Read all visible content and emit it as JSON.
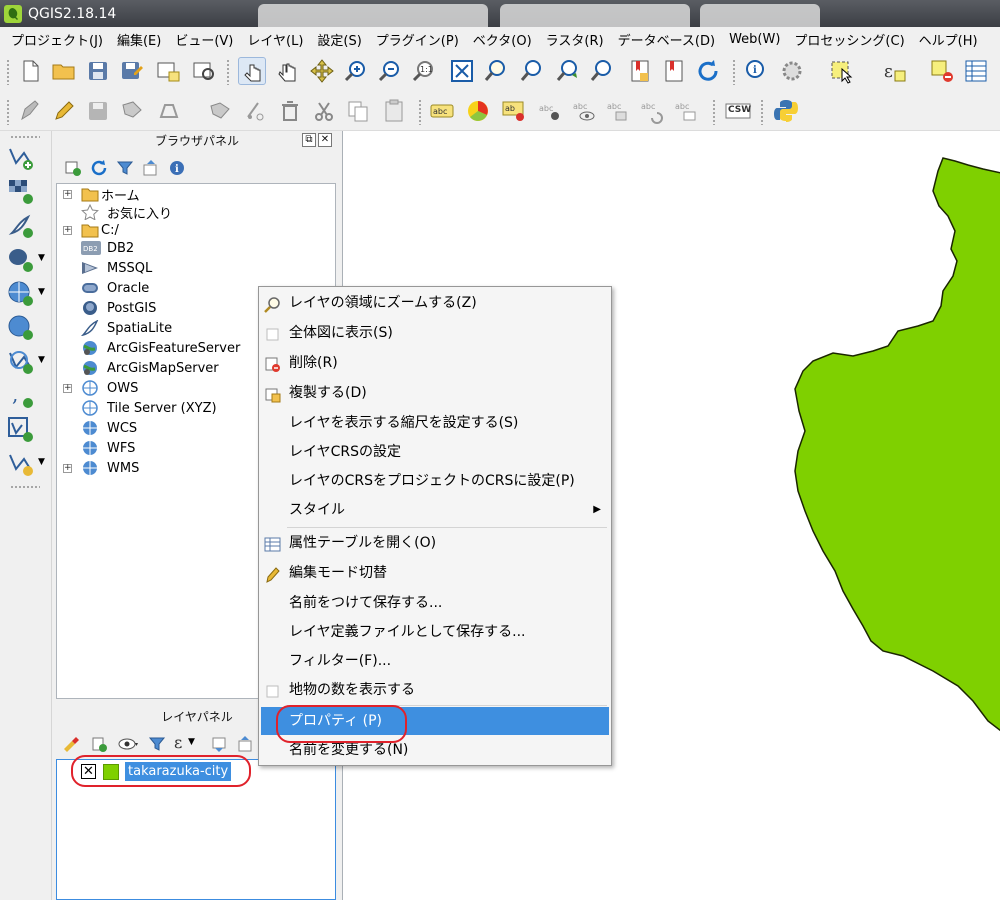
{
  "window": {
    "title": "QGIS2.18.14"
  },
  "menubar": {
    "items": [
      "プロジェクト(J)",
      "編集(E)",
      "ビュー(V)",
      "レイヤ(L)",
      "設定(S)",
      "プラグイン(P)",
      "ベクタ(O)",
      "ラスタ(R)",
      "データベース(D)",
      "Web(W)",
      "プロセッシング(C)",
      "ヘルプ(H)"
    ]
  },
  "toolbar2": {
    "csw_label": "CSW"
  },
  "browser_panel": {
    "title": "ブラウザパネル",
    "items": [
      {
        "label": "ホーム",
        "icon": "folder-icon"
      },
      {
        "label": "お気に入り",
        "icon": "star-icon"
      },
      {
        "label": "C:/",
        "icon": "folder-icon"
      },
      {
        "label": "DB2",
        "icon": "db2-icon"
      },
      {
        "label": "MSSQL",
        "icon": "mssql-icon"
      },
      {
        "label": "Oracle",
        "icon": "oracle-icon"
      },
      {
        "label": "PostGIS",
        "icon": "postgis-icon"
      },
      {
        "label": "SpatiaLite",
        "icon": "spatialite-icon"
      },
      {
        "label": "ArcGisFeatureServer",
        "icon": "arcgis-icon"
      },
      {
        "label": "ArcGisMapServer",
        "icon": "arcgis-icon"
      },
      {
        "label": "OWS",
        "icon": "globe-icon"
      },
      {
        "label": "Tile Server (XYZ)",
        "icon": "globe-icon"
      },
      {
        "label": "WCS",
        "icon": "globe-icon"
      },
      {
        "label": "WFS",
        "icon": "globe-icon"
      },
      {
        "label": "WMS",
        "icon": "globe-icon"
      }
    ]
  },
  "layers_panel": {
    "title": "レイヤパネル",
    "layers": [
      {
        "name": "takarazuka-city",
        "checked": true,
        "color": "#7fd000"
      }
    ]
  },
  "context_menu": {
    "items": [
      {
        "label": "レイヤの領域にズームする(Z)",
        "icon": "zoom-icon"
      },
      {
        "label": "全体図に表示(S)",
        "icon": "checkbox-icon"
      },
      {
        "label": "削除(R)",
        "icon": "remove-icon"
      },
      {
        "label": "複製する(D)",
        "icon": "duplicate-icon"
      },
      {
        "label": "レイヤを表示する縮尺を設定する(S)"
      },
      {
        "label": "レイヤCRSの設定"
      },
      {
        "label": "レイヤのCRSをプロジェクトのCRSに設定(P)"
      },
      {
        "label": "スタイル",
        "submenu": true
      },
      {
        "label": "属性テーブルを開く(O)",
        "icon": "table-icon"
      },
      {
        "label": "編集モード切替",
        "icon": "pencil-icon"
      },
      {
        "label": "名前をつけて保存する..."
      },
      {
        "label": "レイヤ定義ファイルとして保存する..."
      },
      {
        "label": "フィルター(F)..."
      },
      {
        "label": "地物の数を表示する",
        "icon": "checkbox-icon"
      },
      {
        "label": "プロパティ (P)",
        "selected": true
      },
      {
        "label": "名前を変更する(N)"
      }
    ]
  },
  "map": {
    "fill_color": "#7fd000"
  }
}
